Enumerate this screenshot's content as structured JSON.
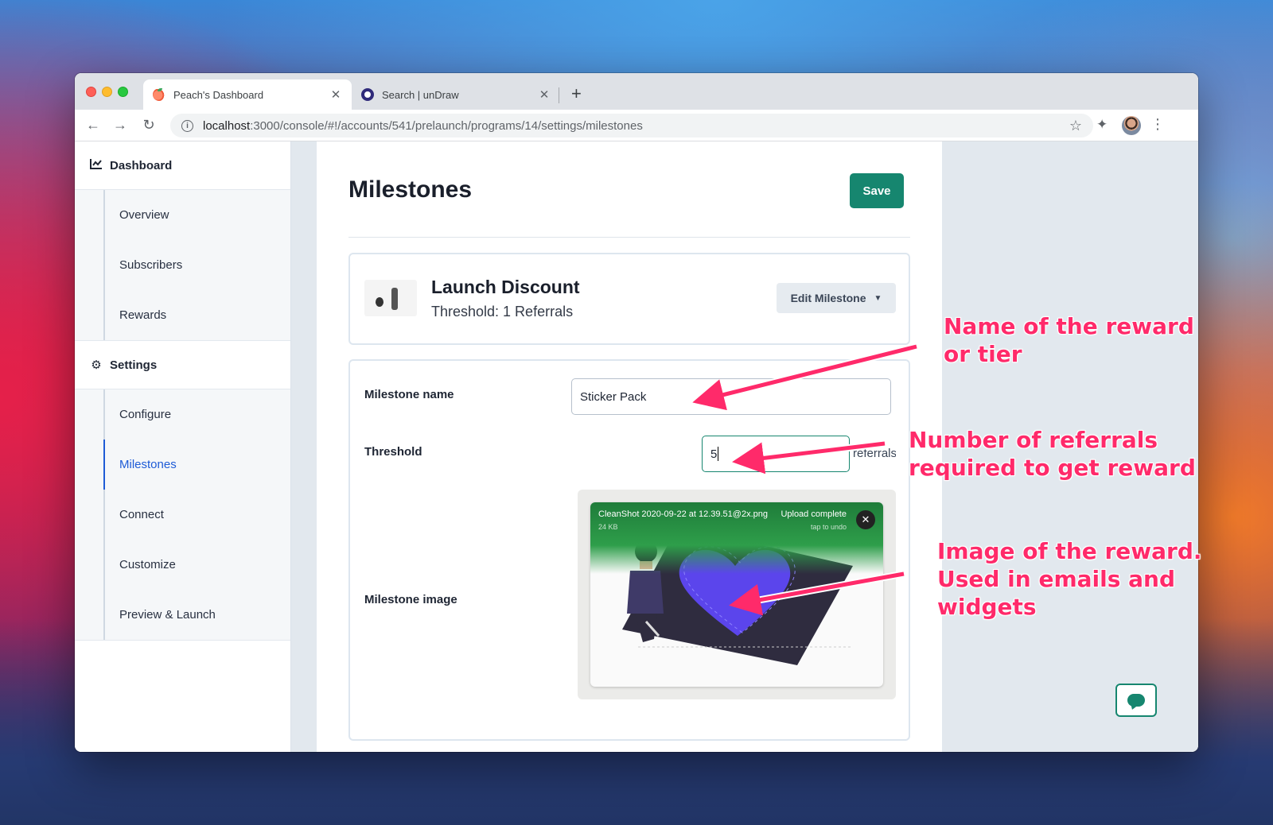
{
  "browser": {
    "tabs": [
      {
        "label": "Peach's Dashboard",
        "icon": "peach-icon",
        "active": true
      },
      {
        "label": "Search | unDraw",
        "icon": "undraw-icon",
        "active": false
      }
    ],
    "url_host": "localhost",
    "url_path": ":3000/console/#!/accounts/541/prelaunch/programs/14/settings/milestones"
  },
  "sidebar": {
    "dashboard": {
      "label": "Dashboard",
      "items": [
        {
          "label": "Overview"
        },
        {
          "label": "Subscribers"
        },
        {
          "label": "Rewards"
        }
      ]
    },
    "settings": {
      "label": "Settings",
      "items": [
        {
          "label": "Configure"
        },
        {
          "label": "Milestones",
          "active": true
        },
        {
          "label": "Connect"
        },
        {
          "label": "Customize"
        },
        {
          "label": "Preview & Launch"
        }
      ]
    }
  },
  "main": {
    "title": "Milestones",
    "save_label": "Save",
    "milestone_card": {
      "name": "Launch Discount",
      "threshold_text": "Threshold: 1 Referrals",
      "edit_label": "Edit Milestone"
    },
    "form": {
      "name_label": "Milestone name",
      "name_value": "Sticker Pack",
      "threshold_label": "Threshold",
      "threshold_value": "5",
      "threshold_suffix": "referrals",
      "image_label": "Milestone image",
      "upload": {
        "filename": "CleanShot 2020-09-22 at 12.39.51@2x.png",
        "size": "24 KB",
        "status": "Upload complete",
        "undo_hint": "tap to undo"
      }
    }
  },
  "annotations": [
    {
      "line1": "Name of the reward",
      "line2": "or tier"
    },
    {
      "line1": "Number of referrals",
      "line2": "required to get reward"
    },
    {
      "line1": "Image of the reward.",
      "line2": "Used in emails and",
      "line3": "widgets"
    }
  ],
  "colors": {
    "accent": "#16866f",
    "link_active": "#1e5bd6",
    "annotation": "#ff2a6a"
  }
}
